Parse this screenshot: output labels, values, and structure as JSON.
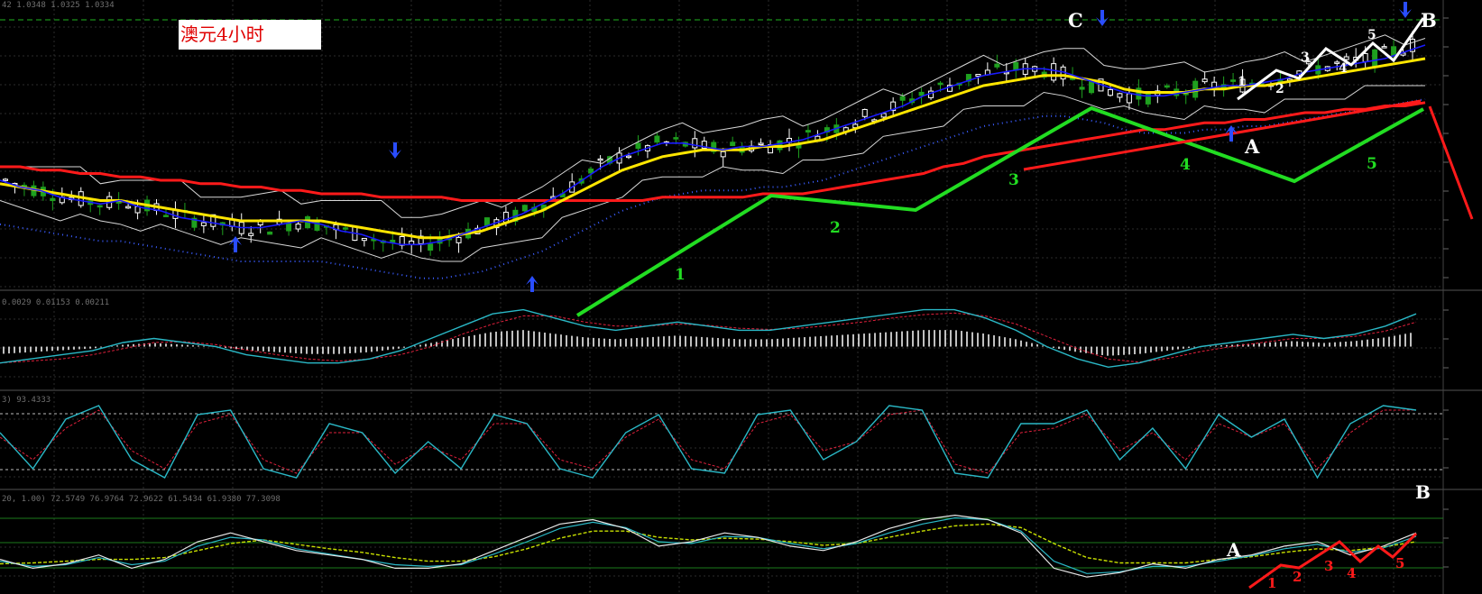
{
  "title": "澳元4小时",
  "panel_headers": {
    "price": "42 1.0348 1.0325 1.0334",
    "macd": "0.0029 0.01153 0.00211",
    "stoch": "3) 93.4333",
    "rsi": "20, 1.00) 72.5749 76.9764 72.9622 61.5434 61.9380 77.3098"
  },
  "colors": {
    "background": "#000000",
    "candle_up": "#ffffff",
    "candle_down": "#1fa01f",
    "ma_fast": "#1a1aff",
    "ma_mid": "#ffe600",
    "ma_slow": "#ff1a1a",
    "bands": "#d8d8d8",
    "wave_green": "#22dd22",
    "wave_white": "#ffffff",
    "wave_red": "#ff1a1a",
    "arrow": "#2a4dff",
    "osc_main": "#2ab8c6",
    "osc_signal": "#e0203c",
    "rsi_yellow": "#c8e000"
  },
  "icons": [
    "arrow-down-icon",
    "arrow-up-icon"
  ],
  "chart_data": [
    {
      "type": "line",
      "panel": "price",
      "series": [
        {
          "values": [
            52,
            50,
            49,
            47,
            46,
            45,
            46,
            44,
            43,
            41,
            40,
            39,
            38,
            38,
            39,
            40,
            39,
            37,
            36,
            34,
            33,
            33,
            34,
            36,
            38,
            40,
            42,
            45,
            48,
            52,
            56,
            59,
            61,
            63,
            63,
            62,
            61,
            62,
            62,
            63,
            64,
            66,
            68,
            70,
            72,
            74,
            77,
            79,
            81,
            83,
            84,
            85,
            85,
            84,
            82,
            80,
            78,
            77,
            77,
            78,
            79,
            80,
            80,
            81,
            82,
            84,
            85,
            86,
            87,
            88,
            90,
            92
          ]
        },
        {
          "values": [
            51,
            50,
            49,
            48,
            47,
            46,
            46,
            45,
            44,
            43,
            42,
            41,
            40,
            40,
            40,
            40,
            40,
            39,
            38,
            37,
            36,
            35,
            35,
            36,
            37,
            39,
            41,
            43,
            46,
            49,
            52,
            55,
            57,
            59,
            60,
            61,
            61,
            61,
            62,
            62,
            63,
            64,
            66,
            68,
            70,
            72,
            74,
            76,
            78,
            80,
            81,
            82,
            83,
            83,
            82,
            81,
            79,
            78,
            78,
            78,
            79,
            79,
            80,
            80,
            81,
            82,
            83,
            84,
            85,
            86,
            87,
            88
          ]
        },
        {
          "values": [
            56,
            56,
            55,
            55,
            54,
            54,
            53,
            53,
            52,
            52,
            51,
            51,
            50,
            50,
            49,
            49,
            48,
            48,
            48,
            47,
            47,
            47,
            47,
            46,
            46,
            46,
            46,
            46,
            46,
            46,
            46,
            46,
            46,
            47,
            47,
            47,
            47,
            47,
            48,
            48,
            48,
            49,
            50,
            51,
            52,
            53,
            54,
            56,
            57,
            59,
            60,
            61,
            62,
            63,
            64,
            65,
            66,
            67,
            67,
            68,
            69,
            69,
            70,
            70,
            71,
            72,
            72,
            73,
            73,
            74,
            74,
            75
          ]
        }
      ],
      "wave_labels": [
        "1",
        "2",
        "3",
        "4",
        "5",
        "C",
        "A",
        "B"
      ],
      "sub_wave_labels": [
        "1",
        "2",
        "3",
        "4",
        "5"
      ]
    },
    {
      "type": "line",
      "panel": "macd",
      "series": [
        {
          "values": [
            -0.4,
            -0.3,
            -0.2,
            -0.1,
            0.1,
            0.2,
            0.1,
            0.0,
            -0.2,
            -0.3,
            -0.4,
            -0.4,
            -0.3,
            -0.1,
            0.2,
            0.5,
            0.8,
            0.9,
            0.7,
            0.5,
            0.4,
            0.5,
            0.6,
            0.5,
            0.4,
            0.4,
            0.5,
            0.6,
            0.7,
            0.8,
            0.9,
            0.9,
            0.7,
            0.4,
            0.0,
            -0.3,
            -0.5,
            -0.4,
            -0.2,
            0.0,
            0.1,
            0.2,
            0.3,
            0.2,
            0.3,
            0.5,
            0.8
          ]
        },
        {
          "values": [
            -0.4,
            -0.35,
            -0.3,
            -0.2,
            -0.05,
            0.1,
            0.12,
            0.05,
            -0.08,
            -0.2,
            -0.3,
            -0.35,
            -0.3,
            -0.2,
            0.0,
            0.3,
            0.55,
            0.75,
            0.75,
            0.6,
            0.5,
            0.5,
            0.55,
            0.52,
            0.45,
            0.42,
            0.45,
            0.52,
            0.6,
            0.7,
            0.78,
            0.82,
            0.75,
            0.55,
            0.25,
            -0.05,
            -0.3,
            -0.38,
            -0.28,
            -0.12,
            0.0,
            0.1,
            0.2,
            0.2,
            0.25,
            0.38,
            0.6
          ]
        }
      ]
    },
    {
      "type": "line",
      "panel": "stochastic",
      "series": [
        {
          "values": [
            60,
            20,
            75,
            90,
            30,
            10,
            80,
            85,
            20,
            10,
            70,
            60,
            15,
            50,
            20,
            80,
            70,
            20,
            10,
            60,
            80,
            20,
            15,
            80,
            85,
            30,
            50,
            90,
            85,
            15,
            10,
            70,
            70,
            85,
            30,
            65,
            20,
            80,
            55,
            75,
            10,
            70,
            90,
            85
          ]
        },
        {
          "values": [
            55,
            30,
            65,
            85,
            40,
            20,
            70,
            80,
            30,
            15,
            60,
            60,
            25,
            45,
            30,
            70,
            70,
            30,
            20,
            55,
            75,
            30,
            20,
            70,
            80,
            40,
            50,
            80,
            85,
            25,
            15,
            60,
            65,
            80,
            40,
            60,
            30,
            70,
            55,
            70,
            20,
            60,
            85,
            85
          ]
        }
      ]
    },
    {
      "type": "line",
      "panel": "rsi",
      "series": [
        {
          "values": [
            30,
            20,
            25,
            35,
            20,
            30,
            50,
            60,
            50,
            40,
            35,
            30,
            20,
            20,
            25,
            40,
            55,
            70,
            75,
            65,
            45,
            50,
            60,
            55,
            45,
            40,
            50,
            65,
            75,
            80,
            75,
            60,
            20,
            10,
            15,
            25,
            20,
            30,
            35,
            45,
            50,
            35,
            45,
            60
          ]
        },
        {
          "values": [
            28,
            22,
            24,
            32,
            24,
            28,
            45,
            55,
            52,
            42,
            36,
            30,
            24,
            22,
            24,
            36,
            50,
            65,
            72,
            66,
            50,
            48,
            56,
            55,
            48,
            42,
            48,
            60,
            70,
            77,
            75,
            62,
            28,
            14,
            16,
            22,
            22,
            28,
            34,
            42,
            47,
            38,
            43,
            56
          ]
        },
        {
          "values": [
            25,
            26,
            28,
            30,
            30,
            32,
            40,
            48,
            52,
            47,
            42,
            38,
            32,
            28,
            28,
            33,
            42,
            54,
            62,
            62,
            55,
            52,
            54,
            53,
            50,
            46,
            48,
            55,
            62,
            68,
            70,
            66,
            48,
            32,
            26,
            26,
            26,
            30,
            33,
            38,
            42,
            40,
            44,
            50
          ]
        }
      ],
      "wave_labels": [
        "A",
        "B",
        "1",
        "2",
        "3",
        "4",
        "5"
      ]
    }
  ]
}
